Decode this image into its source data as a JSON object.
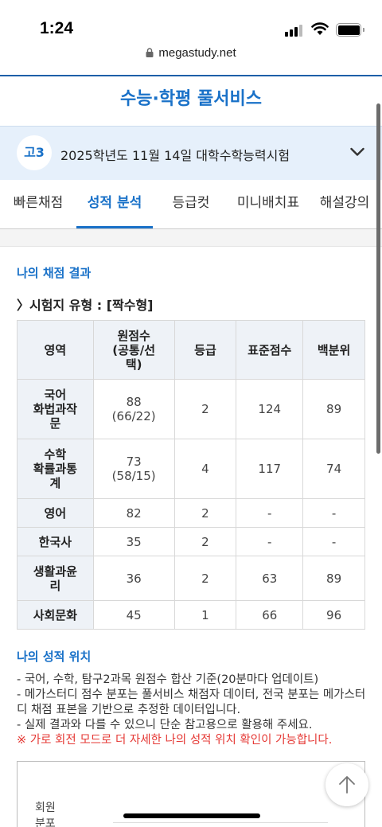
{
  "status_bar": {
    "time": "1:24"
  },
  "browser": {
    "url": "megastudy.net"
  },
  "header": {
    "title": "수능·학평 풀서비스"
  },
  "exam": {
    "grade_badge": "고3",
    "name": "2025학년도 11월 14일 대학수학능력시험"
  },
  "tabs": [
    {
      "label": "빠른채점",
      "active": false
    },
    {
      "label": "성적 분석",
      "active": true
    },
    {
      "label": "등급컷",
      "active": false
    },
    {
      "label": "미니배치표",
      "active": false
    },
    {
      "label": "해설강의",
      "active": false
    }
  ],
  "results": {
    "section_title": "나의 채점 결과",
    "exam_type": "〉시험지 유형 : [짝수형]",
    "columns": [
      "영역",
      "원점수\n(공통/선\n택)",
      "등급",
      "표준점수",
      "백분위"
    ],
    "rows": [
      {
        "subject": "국어\n화법과작\n문",
        "raw": "88\n(66/22)",
        "grade": "2",
        "standard": "124",
        "percentile": "89"
      },
      {
        "subject": "수학\n확률과통\n계",
        "raw": "73\n(58/15)",
        "grade": "4",
        "standard": "117",
        "percentile": "74"
      },
      {
        "subject": "영어",
        "raw": "82",
        "grade": "2",
        "standard": "-",
        "percentile": "-"
      },
      {
        "subject": "한국사",
        "raw": "35",
        "grade": "2",
        "standard": "-",
        "percentile": "-"
      },
      {
        "subject": "생활과윤\n리",
        "raw": "36",
        "grade": "2",
        "standard": "63",
        "percentile": "89"
      },
      {
        "subject": "사회문화",
        "raw": "45",
        "grade": "1",
        "standard": "66",
        "percentile": "96"
      }
    ]
  },
  "position": {
    "section_title": "나의 성적 위치",
    "notes": [
      "- 국어, 수학, 탐구2과목 원점수 합산 기준(20분마다 업데이트)",
      "- 메가스터디 점수 분포는 풀서비스 채점자 데이터, 전국 분포는 메가스터디 채점 표본을 기반으로 추정한 데이터입니다.",
      "- 실제 결과와 다를 수 있으니 단순 참고용으로 활용해 주세요."
    ],
    "notice": "※ 가로 회전 모드로 더 자세한 나의 성적 위치 확인이 가능합니다.",
    "chart_label": "회원\n분포"
  },
  "colors": {
    "accent": "#1971c8",
    "exam_bar_bg": "#e6f0fb",
    "notice": "#e53935"
  }
}
